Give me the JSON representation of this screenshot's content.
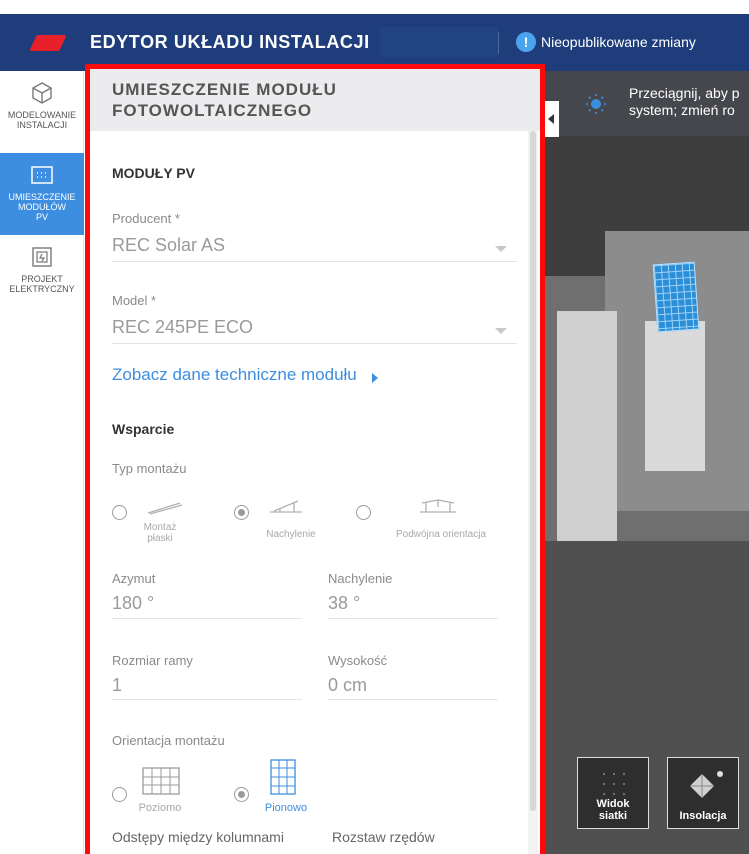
{
  "topbar": {
    "title": "EDYTOR UKŁADU INSTALACJI",
    "status_text": "Nieopublikowane zmiany",
    "status_icon": "exclamation-icon",
    "brand_color": "#e8202a",
    "bar_color": "#1f3d7a"
  },
  "nav": {
    "items": [
      {
        "label": "MODELOWANIE\nINSTALACJI",
        "icon": "cube-icon"
      },
      {
        "label": "UMIESZCZENIE\nMODUŁÓW\nPV",
        "icon": "panel-grid-icon",
        "active": true
      },
      {
        "label": "PROJEKT\nELEKTRYCZNY",
        "icon": "electric-icon"
      }
    ],
    "active_color": "#3d8ee0"
  },
  "panel": {
    "title": "UMIESZCZENIE MODUŁU FOTOWOLTAICZNEGO",
    "modules_section": "MODUŁY PV",
    "producer": {
      "label": "Producent *",
      "value": "REC Solar AS"
    },
    "model": {
      "label": "Model *",
      "value": "REC 245PE ECO"
    },
    "datasheet_link": "Zobacz dane techniczne modułu",
    "support_section": "Wsparcie",
    "mount_type": {
      "label": "Typ montażu",
      "options": [
        "Montaż płaski",
        "Nachylenie",
        "Podwójna orientacja"
      ],
      "selected": "Nachylenie"
    },
    "azimuth": {
      "label": "Azymut",
      "value": "180 °"
    },
    "tilt": {
      "label": "Nachylenie",
      "value": "38 °"
    },
    "frame_size": {
      "label": "Rozmiar ramy",
      "value": "1"
    },
    "height": {
      "label": "Wysokość",
      "value": "0 cm"
    },
    "orientation": {
      "label": "Orientacja montażu",
      "options": [
        "Poziomo",
        "Pionowo"
      ],
      "selected": "Pionowo"
    },
    "col_spacing_label": "Odstępy między kolumnami",
    "row_spacing_label": "Rozstaw rzędów",
    "highlight_color": "#ff0a0a",
    "link_color": "#3d8ee0"
  },
  "map": {
    "hint": "Przeciągnij, aby p\nsystem; zmień ro",
    "grid_button": "Widok\nsiatki",
    "insolation_button": "Insolacja",
    "module_color": "#2a8fd6"
  }
}
